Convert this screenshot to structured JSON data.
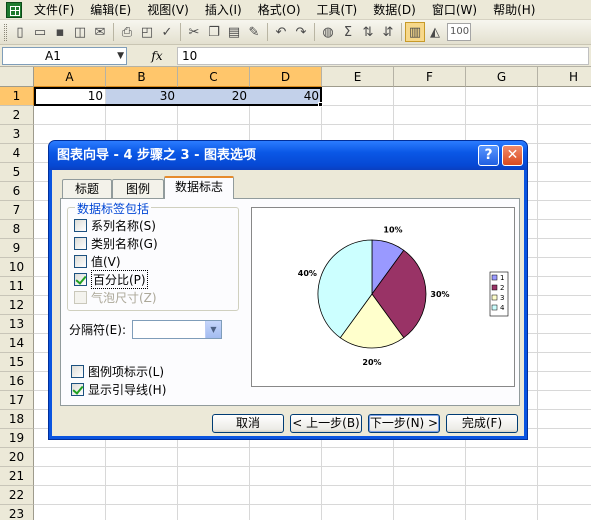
{
  "menu": {
    "items": [
      "文件(F)",
      "编辑(E)",
      "视图(V)",
      "插入(I)",
      "格式(O)",
      "工具(T)",
      "数据(D)",
      "窗口(W)",
      "帮助(H)"
    ]
  },
  "toolbar": {
    "icons": [
      "new-icon",
      "open-icon",
      "save-icon",
      "permission-icon",
      "email-icon",
      "print-icon",
      "print-preview-icon",
      "spelling-icon",
      "cut-icon",
      "copy-icon",
      "paste-icon",
      "format-painter-icon",
      "undo-icon",
      "redo-icon",
      "hyperlink-icon",
      "autosum-icon",
      "sort-ascending-icon",
      "sort-descending-icon",
      "chart-wizard-icon",
      "drawing-icon"
    ],
    "zoom": "100"
  },
  "formula_bar": {
    "name_box": "A1",
    "fx": "fx",
    "value": "10"
  },
  "sheet": {
    "columns": [
      "A",
      "B",
      "C",
      "D",
      "E",
      "F",
      "G",
      "H"
    ],
    "rows": [
      "1",
      "2",
      "3",
      "4",
      "5",
      "6",
      "7",
      "8",
      "9",
      "10",
      "11",
      "12",
      "13",
      "14",
      "15",
      "16",
      "17",
      "18",
      "19",
      "20",
      "21",
      "22",
      "23"
    ],
    "row1": [
      "10",
      "30",
      "20",
      "40"
    ]
  },
  "dialog": {
    "title": "图表向导 - 4 步骤之 3 - 图表选项",
    "help_glyph": "?",
    "close_glyph": "✕",
    "tabs": [
      "标题",
      "图例",
      "数据标志"
    ],
    "active_tab": "数据标志",
    "group_title": "数据标签包括",
    "options": [
      {
        "label": "系列名称(S)",
        "checked": false,
        "disabled": false
      },
      {
        "label": "类别名称(G)",
        "checked": false,
        "disabled": false
      },
      {
        "label": "值(V)",
        "checked": false,
        "disabled": false
      },
      {
        "label": "百分比(P)",
        "checked": true,
        "disabled": false
      },
      {
        "label": "气泡尺寸(Z)",
        "checked": false,
        "disabled": true
      }
    ],
    "separator_label": "分隔符(E):",
    "separator_value": "",
    "legend_key": {
      "label": "图例项标示(L)",
      "checked": false
    },
    "leader_lines": {
      "label": "显示引导线(H)",
      "checked": true
    },
    "buttons": {
      "cancel": "取消",
      "back": "< 上一步(B)",
      "next": "下一步(N) >",
      "finish": "完成(F)"
    }
  },
  "chart_data": {
    "type": "pie",
    "categories": [
      "1",
      "2",
      "3",
      "4"
    ],
    "values": [
      10,
      30,
      20,
      40
    ],
    "labels": [
      "10%",
      "30%",
      "20%",
      "40%"
    ],
    "colors": [
      "#9999ff",
      "#993366",
      "#ffffcc",
      "#ccffff"
    ],
    "legend_position": "right"
  }
}
